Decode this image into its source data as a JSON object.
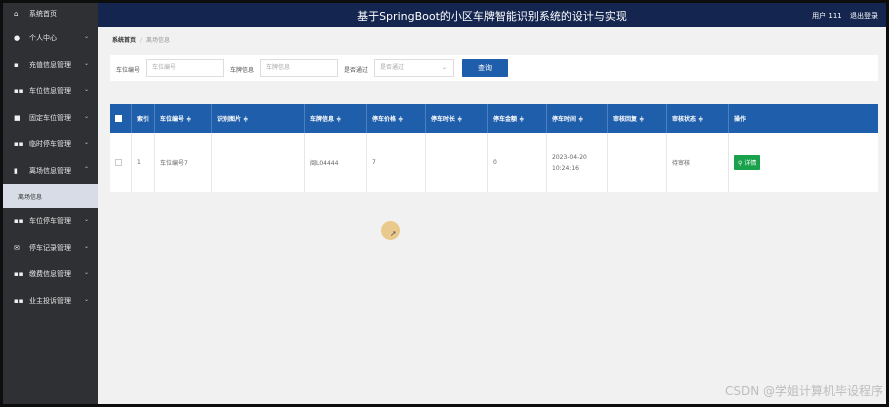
{
  "app": {
    "title": "基于SpringBoot的小区车牌智能识别系统的设计与实现",
    "user_label": "用户 111",
    "logout_label": "退出登录"
  },
  "sidebar": {
    "items": [
      {
        "label": "系统首页",
        "icon": "home-icon",
        "chevron": false
      },
      {
        "label": "个人中心",
        "icon": "user-icon",
        "chevron": true
      },
      {
        "label": "充值信息管理",
        "icon": "wallet-icon",
        "chevron": true
      },
      {
        "label": "车位信息管理",
        "icon": "grid-icon",
        "chevron": true
      },
      {
        "label": "固定车位管理",
        "icon": "book-icon",
        "chevron": true
      },
      {
        "label": "临时停车管理",
        "icon": "grid-icon",
        "chevron": true
      },
      {
        "label": "离场信息管理",
        "icon": "bar-chart-icon",
        "chevron": true,
        "expanded": true
      },
      {
        "label": "车位停车管理",
        "icon": "grid-icon",
        "chevron": true
      },
      {
        "label": "停车记录管理",
        "icon": "envelope-icon",
        "chevron": true
      },
      {
        "label": "缴费信息管理",
        "icon": "grid-icon",
        "chevron": true
      },
      {
        "label": "业主投诉管理",
        "icon": "grid-icon",
        "chevron": true
      }
    ],
    "sub_item": "离场信息"
  },
  "breadcrumb": {
    "home": "系统首页",
    "current": "离场信息"
  },
  "search": {
    "label1": "车位编号",
    "placeholder1": "车位编号",
    "label2": "车牌信息",
    "placeholder2": "车牌信息",
    "label3": "是否通过",
    "select_value": "是否通过",
    "button": "查询"
  },
  "table": {
    "headers": [
      "索引",
      "车位编号 ≑",
      "识别图片 ≑",
      "车牌信息 ≑",
      "停车价格 ≑",
      "停车时长 ≑",
      "停车金额 ≑",
      "停车时间 ≑",
      "审核回复 ≑",
      "审核状态 ≑",
      "操作"
    ],
    "rows": [
      {
        "index": "1",
        "spot_no": "车位编号7",
        "image": "",
        "plate": "闽L04444",
        "price": "7",
        "duration": "",
        "amount": "0",
        "time": "2023-04-20 10:24:16",
        "reply": "",
        "status": "待审核",
        "action": "详情"
      }
    ]
  },
  "watermark": "CSDN @学姐计算机毕设程序",
  "colors": {
    "topbar": "#14264f",
    "sidebar": "#2f3033",
    "table_header": "#1f5eab",
    "detail_button": "#19a14b"
  }
}
